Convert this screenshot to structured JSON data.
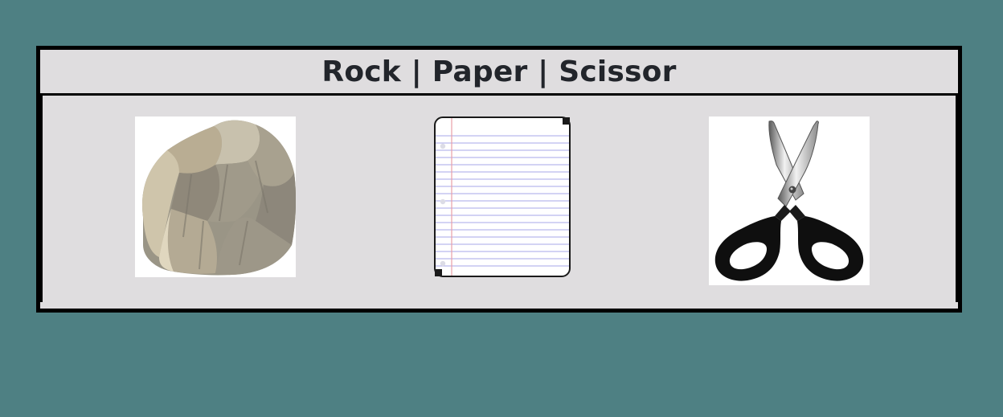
{
  "colors": {
    "page_background": "#4e8083",
    "panel_background": "#dfdddf",
    "border": "#000000",
    "title_text": "#22252b"
  },
  "game": {
    "title": "Rock | Paper | Scissor",
    "choices": [
      {
        "id": "rock",
        "icon": "rock-icon"
      },
      {
        "id": "paper",
        "icon": "paper-icon"
      },
      {
        "id": "scissor",
        "icon": "scissor-icon"
      }
    ]
  }
}
